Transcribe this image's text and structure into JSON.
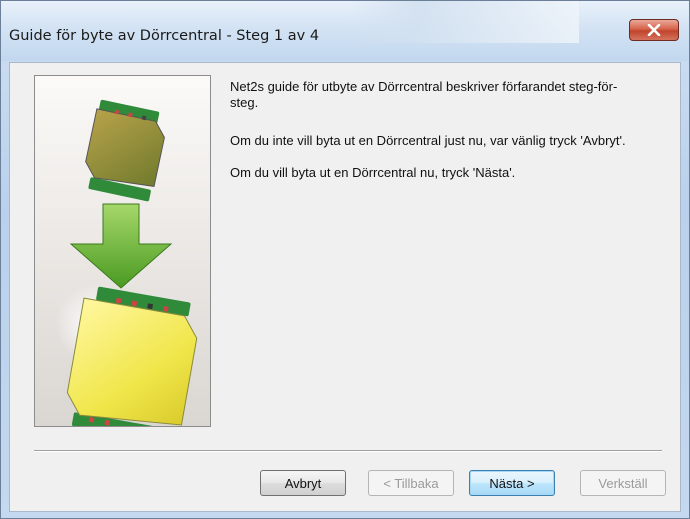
{
  "window": {
    "title": "Guide för byte av Dörrcentral - Steg 1 av 4",
    "close_icon": "close-icon",
    "close_color": "#c9462f"
  },
  "content": {
    "paragraph_1": "Net2s guide för utbyte av Dörrcentral beskriver förfarandet steg-för-steg.",
    "paragraph_2": "Om du inte vill byta ut en Dörrcentral just nu, var vänlig tryck 'Avbryt'.",
    "paragraph_3": "Om du vill byta ut en Dörrcentral nu, tryck 'Nästa'."
  },
  "illustration": {
    "icons": [
      "old-door-controller-icon",
      "down-arrow-icon",
      "new-door-controller-icon"
    ],
    "arrow_color": "#5aa02c",
    "board_color": "#2f8a3a",
    "old_unit_color": "#8a8a3a",
    "new_unit_color": "#e9e24a"
  },
  "buttons": {
    "cancel": "Avbryt",
    "back": "< Tillbaka",
    "next": "Nästa >",
    "apply": "Verkställ"
  }
}
